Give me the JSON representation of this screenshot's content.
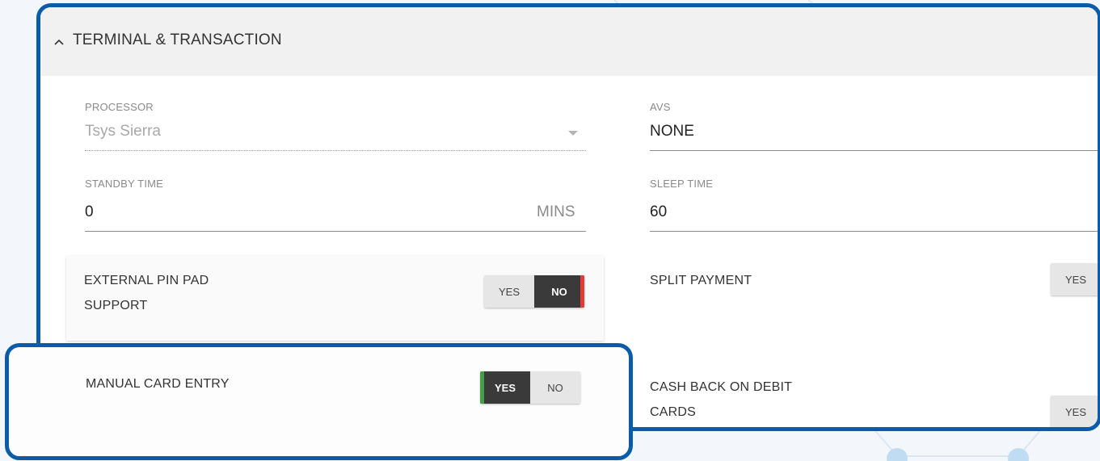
{
  "section": {
    "chevron_icon": "chevron-up-icon",
    "title": "TERMINAL & TRANSACTION"
  },
  "fields": {
    "processor": {
      "label": "PROCESSOR",
      "value": "Tsys Sierra",
      "disabled": true
    },
    "avs": {
      "label": "AVS",
      "value": "NONE"
    },
    "standby_time": {
      "label": "STANDBY TIME",
      "value": "0",
      "suffix": "MINS"
    },
    "sleep_time": {
      "label": "SLEEP TIME",
      "value": "60"
    }
  },
  "options": {
    "external_pin_pad": {
      "label_line1": "EXTERNAL PIN PAD",
      "label_line2": "SUPPORT",
      "yes": "YES",
      "no": "NO",
      "selected": "NO"
    },
    "split_payment": {
      "label": "SPLIT PAYMENT",
      "yes": "YES"
    },
    "manual_card_entry": {
      "label": "MANUAL CARD ENTRY",
      "yes": "YES",
      "no": "NO",
      "selected": "YES"
    },
    "cash_back_debit": {
      "label_line1": "CASH BACK ON DEBIT",
      "label_line2": "CARDS",
      "yes": "YES"
    }
  },
  "colors": {
    "highlight_frame": "#0b5ca8",
    "toggle_active": "#3a3a3a",
    "no_accent": "#e53935",
    "yes_accent": "#43a047"
  }
}
